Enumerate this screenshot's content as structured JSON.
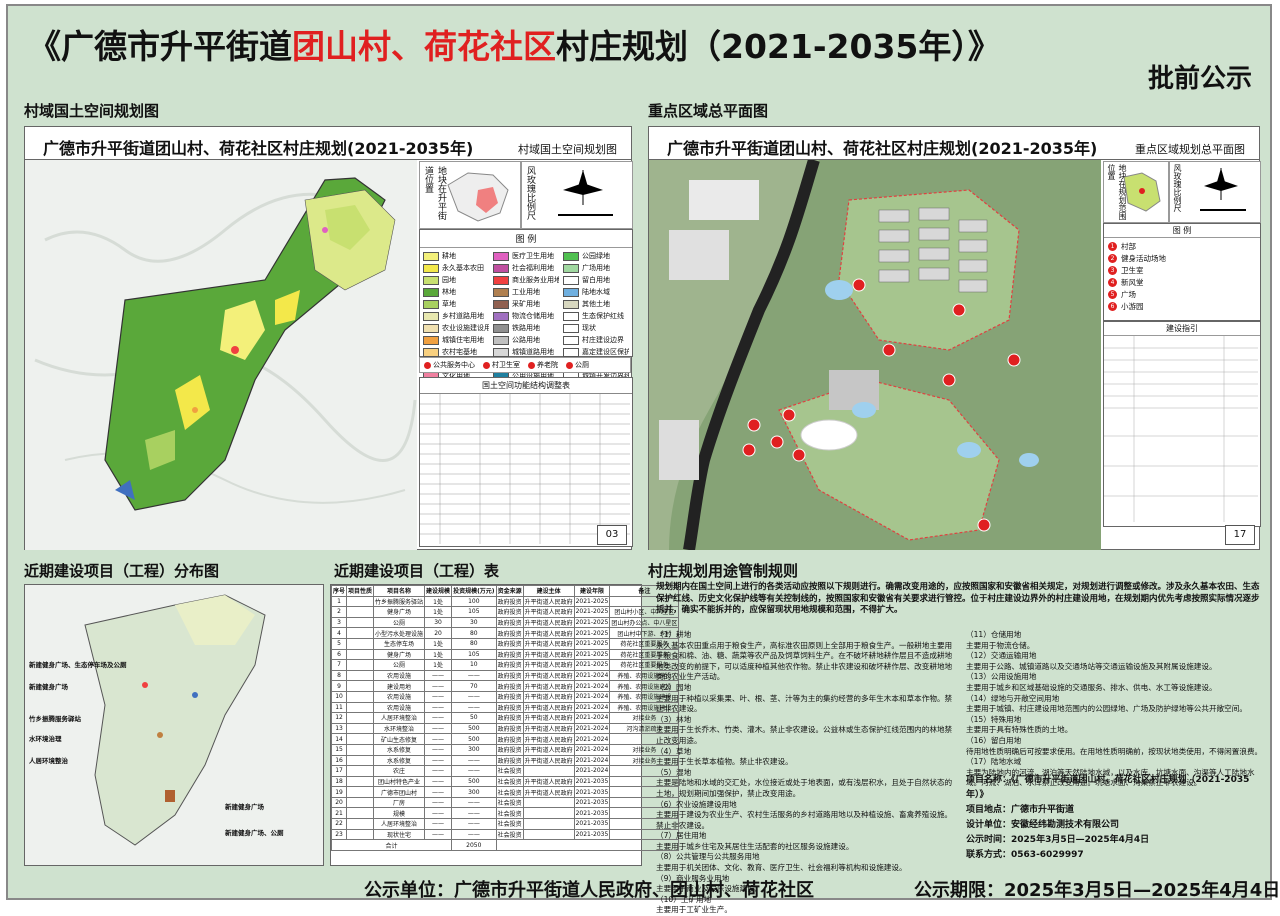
{
  "title": {
    "prefix": "《广德市升平街道",
    "red": "团山村、荷花社区",
    "suffix": "村庄规划（2021-2035年）》",
    "stamp": "批前公示"
  },
  "sections": {
    "land_plan": "村域国土空间规划图",
    "key_area": "重点区域总平面图",
    "near_term_map": "近期建设项目（工程）分布图",
    "near_term_table": "近期建设项目（工程）表",
    "rules": "村庄规划用途管制规则"
  },
  "panel_land": {
    "title": "广德市升平街道团山村、荷花社区村庄规划(2021-2035年)",
    "subtitle": "村域国土空间规划图",
    "page": "03",
    "location_label": "地块在升平街道位置",
    "wind_label": "风玫瑰比例尺",
    "legend_title": "图 例",
    "legend": [
      {
        "label": "耕地",
        "color": "#f3f07a"
      },
      {
        "label": "医疗卫生用地",
        "color": "#e060c0"
      },
      {
        "label": "公园绿地",
        "color": "#50c050"
      },
      {
        "label": "永久基本农田",
        "color": "#f3e84a"
      },
      {
        "label": "社会福利用地",
        "color": "#c050a0"
      },
      {
        "label": "广场用地",
        "color": "#a0d8a0"
      },
      {
        "label": "园地",
        "color": "#c8e070"
      },
      {
        "label": "商业服务业用地",
        "color": "#f04040"
      },
      {
        "label": "留白用地",
        "color": "#ffffff"
      },
      {
        "label": "林地",
        "color": "#5aa83a"
      },
      {
        "label": "工业用地",
        "color": "#b08050"
      },
      {
        "label": "陆地水域",
        "color": "#70b0e0"
      },
      {
        "label": "草地",
        "color": "#a8d060"
      },
      {
        "label": "采矿用地",
        "color": "#906050"
      },
      {
        "label": "其他土地",
        "color": "#d8d8c0"
      },
      {
        "label": "乡村道路用地",
        "color": "#e8e8b0"
      },
      {
        "label": "物流仓储用地",
        "color": "#a070c0"
      },
      {
        "label": "生态保护红线",
        "color": "#ffffff"
      },
      {
        "label": "农业设施建设用地",
        "color": "#f0e0b0"
      },
      {
        "label": "铁路用地",
        "color": "#909090"
      },
      {
        "label": "现状",
        "color": "#ffffff"
      },
      {
        "label": "城镇住宅用地",
        "color": "#f0a040"
      },
      {
        "label": "公路用地",
        "color": "#c0c0c0"
      },
      {
        "label": "村庄建设边界",
        "color": "#ffffff"
      },
      {
        "label": "农村宅基地",
        "color": "#f8d080"
      },
      {
        "label": "城镇道路用地",
        "color": "#d8d8d8"
      },
      {
        "label": "嘉定建设区保护范围",
        "color": "#ffffff"
      },
      {
        "label": "机关团体用地",
        "color": "#e090c0"
      },
      {
        "label": "交通场站用地",
        "color": "#b0b0b0"
      },
      {
        "label": "规划城市边界",
        "color": "#ffffff"
      },
      {
        "label": "文化用地",
        "color": "#f080a0"
      },
      {
        "label": "公用设施用地",
        "color": "#2080a0"
      },
      {
        "label": "城镇开发边界线",
        "color": "#ffffff"
      },
      {
        "label": "教育用地",
        "color": "#f0a0c0"
      },
      {
        "label": "水工设施用地",
        "color": "#206080"
      },
      {
        "label": "村域范围",
        "color": "#ffffff"
      }
    ],
    "symbols": [
      "公共服务中心",
      "村卫生室",
      "养老院",
      "公厕"
    ],
    "table_title": "国土空间功能结构调整表"
  },
  "panel_key": {
    "title": "广德市升平街道团山村、荷花社区村庄规划(2021-2035年)",
    "subtitle": "重点区域规划总平面图",
    "page": "17",
    "location_label": "地块在规划范围位置",
    "wind_label": "风玫瑰比例尺",
    "legend_title": "图 例",
    "legend": [
      "村部",
      "健身活动场地",
      "卫生室",
      "新风堂",
      "广场",
      "小游园"
    ],
    "guide_title": "建设指引",
    "markers": [
      "1",
      "5",
      "2",
      "3",
      "4",
      "5",
      "6",
      "6",
      "6",
      "6",
      "6"
    ]
  },
  "near_map": {
    "labels": [
      "新建健身广场、生态停车场及公厕",
      "新建健身广场",
      "竹乡振腾服务驿站",
      "水环境治理",
      "人居环境整治",
      "新建健身广场",
      "新建健身广场、公厕"
    ]
  },
  "proj_table": {
    "headers": [
      "序号",
      "项目性质",
      "项目名称",
      "建设规模",
      "投资规模(万元)",
      "资金来源",
      "建设主体",
      "建设年限",
      "备注"
    ],
    "rows": [
      [
        "1",
        "",
        "竹乡振腾服务驿站",
        "1处",
        "100",
        "政府投资",
        "升平街道人民政府",
        "2021-2025",
        ""
      ],
      [
        "2",
        "",
        "健身广场",
        "1处",
        "105",
        "政府投资",
        "升平街道人民政府",
        "2021-2025",
        "团山村小区、中八星区"
      ],
      [
        "3",
        "",
        "公厕",
        "30",
        "30",
        "政府投资",
        "升平街道人民政府",
        "2021-2025",
        "团山村办公点、中八星区"
      ],
      [
        "4",
        "",
        "小型污水处理设施",
        "20",
        "80",
        "政府投资",
        "升平街道人民政府",
        "2021-2025",
        "团山村中下游、乡村"
      ],
      [
        "5",
        "",
        "生态停车场",
        "1处",
        "80",
        "政府投资",
        "升平街道人民政府",
        "2021-2025",
        "荷花社区重要服务"
      ],
      [
        "6",
        "",
        "健身广场",
        "1处",
        "105",
        "政府投资",
        "升平街道人民政府",
        "2021-2025",
        "荷花社区重要服务"
      ],
      [
        "7",
        "",
        "公厕",
        "1处",
        "10",
        "政府投资",
        "升平街道人民政府",
        "2021-2025",
        "荷花社区重要服务"
      ],
      [
        "8",
        "",
        "农用设施",
        "——",
        "——",
        "政府投资",
        "升平街道人民政府",
        "2021-2024",
        "养殖、农用设施建设"
      ],
      [
        "9",
        "",
        "建设用地",
        "——",
        "70",
        "政府投资",
        "升平街道人民政府",
        "2021-2024",
        "养殖、农用设施建设"
      ],
      [
        "10",
        "",
        "农用设施",
        "——",
        "——",
        "政府投资",
        "升平街道人民政府",
        "2021-2024",
        "养殖、农用设施建设"
      ],
      [
        "11",
        "",
        "农用设施",
        "——",
        "——",
        "政府投资",
        "升平街道人民政府",
        "2021-2024",
        "养殖、农用设施建设"
      ],
      [
        "12",
        "",
        "人居环境整治",
        "——",
        "50",
        "政府投资",
        "升平街道人民政府",
        "2021-2024",
        "对接业务"
      ],
      [
        "13",
        "",
        "水环境整治",
        "——",
        "500",
        "政府投资",
        "升平街道人民政府",
        "2021-2024",
        "河沟清淤疏浚"
      ],
      [
        "14",
        "",
        "矿山生态修复",
        "——",
        "500",
        "政府投资",
        "升平街道人民政府",
        "2021-2024",
        ""
      ],
      [
        "15",
        "",
        "水系修复",
        "——",
        "300",
        "政府投资",
        "升平街道人民政府",
        "2021-2024",
        "对接业务"
      ],
      [
        "16",
        "",
        "水系修复",
        "——",
        "——",
        "政府投资",
        "升平街道人民政府",
        "2021-2024",
        "对接业务"
      ],
      [
        "17",
        "",
        "农庄",
        "——",
        "——",
        "社会投资",
        "",
        "2021-2024",
        ""
      ],
      [
        "18",
        "",
        "团山村特色产业",
        "——",
        "500",
        "社会投资",
        "升平街道人民政府",
        "2021-2035",
        ""
      ],
      [
        "19",
        "",
        "广德市团山村",
        "——",
        "300",
        "社会投资",
        "升平街道人民政府",
        "2021-2035",
        ""
      ],
      [
        "20",
        "",
        "厂房",
        "——",
        "——",
        "社会投资",
        "",
        "2021-2035",
        ""
      ],
      [
        "21",
        "",
        "规模",
        "——",
        "——",
        "社会投资",
        "",
        "2021-2035",
        ""
      ],
      [
        "22",
        "",
        "人居环境整治",
        "——",
        "——",
        "社会投资",
        "",
        "2021-2035",
        ""
      ],
      [
        "23",
        "",
        "现状住宅",
        "——",
        "——",
        "社会投资",
        "",
        "2021-2035",
        ""
      ]
    ],
    "total_label": "合计",
    "total_value": "2050"
  },
  "rules": {
    "intro": "规划期内在国土空间上进行的各类活动应按照以下规则进行。确需改变用途的，应按照国家和安徽省相关规定，对规划进行调整或修改。涉及永久基本农田、生态保护红线、历史文化保护线等有关控制线的，按照国家和安徽省有关要求进行管控。位于村庄建设边界外的村庄建设用地，在规划期内优先考虑按照实际情况逐步拆并，确实不能拆并的，应保留现状用地规模和范围，不得扩大。",
    "left": [
      "（1）耕地",
      "永久基本农田重点用于粮食生产，高标准农田原则上全部用于粮食生产。一般耕地主要用于粮食和棉、油、糖、蔬菜等农产品及饲草饲料生产。在不破坏耕地耕作层且不造成耕地地类改变的前提下，可以适度种植其他农作物。禁止非农建设和破坏耕作层、改变耕地地类的农业生产活动。",
      "（2）园地",
      "主要用于种植以采集果、叶、根、茎、汁等为主的集约经营的多年生木本和草本作物。禁止非农建设。",
      "（3）林地",
      "主要用于生长乔木、竹类、灌木。禁止非农建设。公益林或生态保护红线范围内的林地禁止改变用途。",
      "（4）草地",
      "主要用于生长草本植物。禁止非农建设。",
      "（5）湿地",
      "主要是陆地和水域的交汇处，水位接近或处于地表面，或有浅层积水，且处于自然状态的土地，规划期间加强保护，禁止改变用途。",
      "（6）农业设施建设用地",
      "主要用于建设为农业生产、农村生活服务的乡村道路用地以及种植设施、畜禽养殖设施。禁止非农建设。",
      "（7）居住用地",
      "主要用于城乡住宅及其居住生活配套的社区服务设施建设。",
      "（8）公共管理与公共服务用地",
      "主要用于机关团体、文化、教育、医疗卫生、社会福利等机构和设施建设。",
      "（9）商业服务业用地",
      "主要用于商业及娱乐设施建设。",
      "（10）工矿用地",
      "主要用于工矿业生产。"
    ],
    "right": [
      "（11）仓储用地",
      "主要用于物流仓储。",
      "（12）交通运输用地",
      "主要用于公路、城镇道路以及交通场站等交通运输设施及其附属设施建设。",
      "（13）公用设施用地",
      "主要用于城乡和区域基础设施的交通服务、排水、供电、水工等设施建设。",
      "（14）绿地与开敞空间用地",
      "主要用于城镇、村庄建设用地范围内的公园绿地、广场及防护绿地等公共开敞空间。",
      "（15）特殊用地",
      "主要用于具有特殊性质的土地。",
      "（16）留白用地",
      "待用地性质明确后可按要求使用。在用地性质明确前，按现状地类使用，不得闲置浪费。",
      "（17）陆地水域",
      "主要为陆地内的河流、湖泊等天然陆地水域，以及水库、坑塘水面、沟渠等人工陆地水域。河流、湖泊、水库禁止改变用途。坑塘水面、沟渠禁止非农建设。"
    ]
  },
  "project_info": {
    "name_label": "项目名称：",
    "name": "《广德市升平街道团山村、荷花社区村庄规划（2021-2035年）》",
    "site_label": "项目地点：",
    "site": "广德市升平街道",
    "designer_label": "设计单位：",
    "designer": "安徽经纬勘测技术有限公司",
    "period_label": "公示时间：",
    "period": "2025年3月5日—2025年4月4日",
    "phone_label": "联系方式：",
    "phone": "0563-6029997"
  },
  "footer": {
    "unit": "公示单位：广德市升平街道人民政府、团山村、荷花社区",
    "period": "公示期限：2025年3月5日—2025年4月4日"
  }
}
